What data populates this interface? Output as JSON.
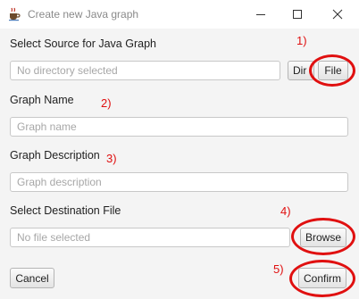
{
  "window": {
    "title": "Create new Java graph"
  },
  "icons": {
    "app": "java-coffee-cup-icon",
    "minimize": "minimize-icon",
    "maximize": "maximize-icon",
    "close": "close-icon"
  },
  "source": {
    "label": "Select Source for Java Graph",
    "placeholder": "No directory selected",
    "dir_button": "Dir",
    "file_button": "File"
  },
  "graph_name": {
    "label": "Graph Name",
    "placeholder": "Graph name"
  },
  "graph_description": {
    "label": "Graph Description",
    "placeholder": "Graph description"
  },
  "destination": {
    "label": "Select Destination File",
    "placeholder": "No file selected",
    "browse_button": "Browse"
  },
  "footer": {
    "cancel_button": "Cancel",
    "confirm_button": "Confirm"
  },
  "annotations": [
    "1)",
    "2)",
    "3)",
    "4)",
    "5)"
  ],
  "colors": {
    "annotation": "#e01010",
    "background": "#f4f4f4"
  }
}
